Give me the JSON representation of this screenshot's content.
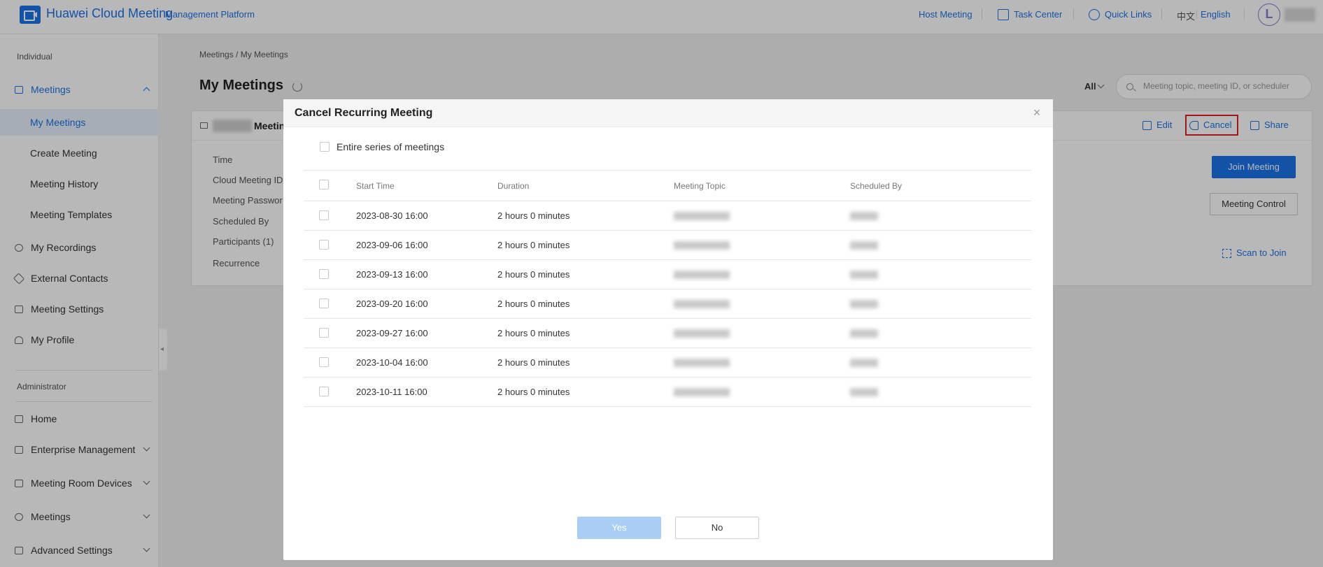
{
  "topbar": {
    "brand": "Huawei Cloud Meeting",
    "brand_sub": "Management Platform",
    "host_meeting": "Host Meeting",
    "task_center": "Task Center",
    "quick_links": "Quick Links",
    "lang_zh": "中文",
    "lang_en": "English",
    "avatar_initial": "L"
  },
  "sidebar": {
    "section_individual": "Individual",
    "meetings_group": "Meetings",
    "my_meetings": "My Meetings",
    "create_meeting": "Create Meeting",
    "meeting_history": "Meeting History",
    "meeting_templates": "Meeting Templates",
    "my_recordings": "My Recordings",
    "external_contacts": "External Contacts",
    "meeting_settings": "Meeting Settings",
    "my_profile": "My Profile",
    "section_admin": "Administrator",
    "home": "Home",
    "enterprise_management": "Enterprise Management",
    "meeting_room_devices": "Meeting Room Devices",
    "meetings_admin": "Meetings",
    "advanced_settings": "Advanced Settings"
  },
  "main": {
    "breadcrumb": "Meetings   /   My Meetings",
    "title": "My Meetings",
    "filter": "All",
    "search_placeholder": "Meeting topic, meeting ID, or scheduler",
    "card_title": "Meetin",
    "edit": "Edit",
    "cancel": "Cancel",
    "share": "Share",
    "labels": {
      "time": "Time",
      "meeting_id": "Cloud Meeting ID",
      "password": "Meeting Passwor",
      "scheduled_by": "Scheduled By",
      "participants": "Participants (1)",
      "recurrence": "Recurrence"
    },
    "join_meeting": "Join Meeting",
    "meeting_control": "Meeting Control",
    "scan_to_join": "Scan to Join"
  },
  "modal": {
    "title": "Cancel Recurring Meeting",
    "close": "×",
    "entire_series": "Entire series of meetings",
    "columns": [
      "Start Time",
      "Duration",
      "Meeting Topic",
      "Scheduled By"
    ],
    "rows": [
      {
        "start": "2023-08-30 16:00",
        "duration": "2 hours 0 minutes"
      },
      {
        "start": "2023-09-06 16:00",
        "duration": "2 hours 0 minutes"
      },
      {
        "start": "2023-09-13 16:00",
        "duration": "2 hours 0 minutes"
      },
      {
        "start": "2023-09-20 16:00",
        "duration": "2 hours 0 minutes"
      },
      {
        "start": "2023-09-27 16:00",
        "duration": "2 hours 0 minutes"
      },
      {
        "start": "2023-10-04 16:00",
        "duration": "2 hours 0 minutes"
      },
      {
        "start": "2023-10-11 16:00",
        "duration": "2 hours 0 minutes"
      }
    ],
    "yes": "Yes",
    "no": "No"
  }
}
